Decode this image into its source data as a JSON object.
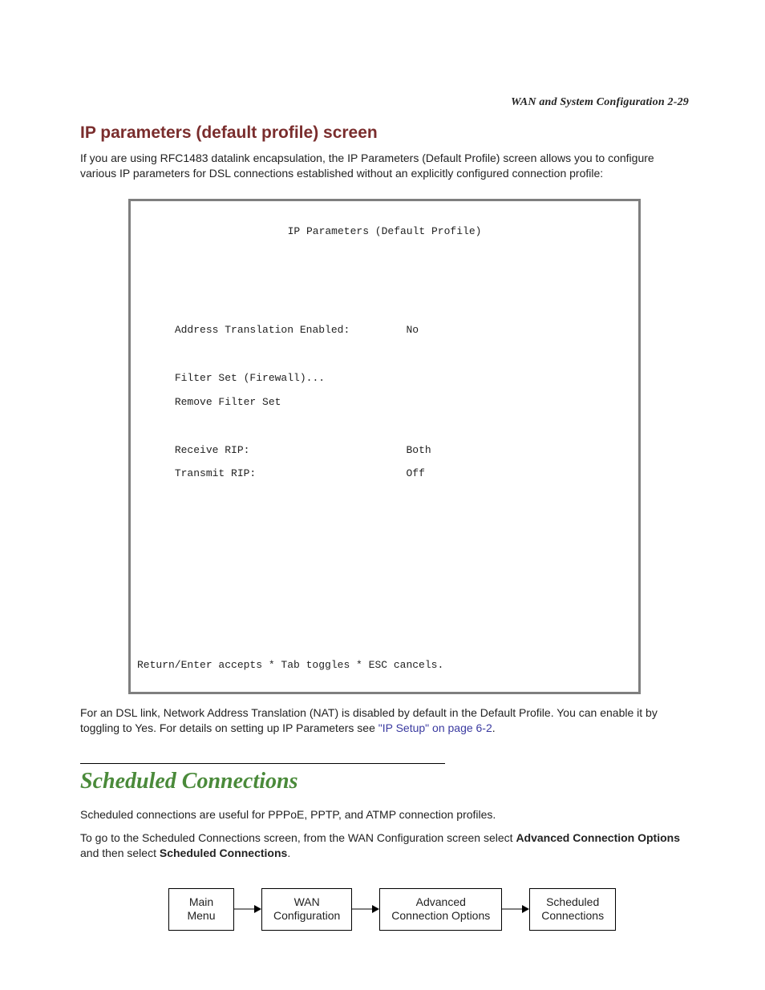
{
  "running_head": "WAN and System Configuration   2-29",
  "section1": {
    "heading": "IP parameters (default profile) screen",
    "para": "If you are using RFC1483 datalink encapsulation, the IP Parameters (Default Profile) screen allows you to configure various IP parameters for DSL connections established without an explicitly configured connection profile:"
  },
  "terminal": {
    "title": "IP Parameters (Default Profile)",
    "rows": [
      {
        "label": "Address Translation Enabled:",
        "value": "No"
      },
      {
        "label": "Filter Set (Firewall)...",
        "value": ""
      },
      {
        "label": "Remove Filter Set",
        "value": ""
      },
      {
        "label": "Receive RIP:",
        "value": "Both"
      },
      {
        "label": "Transmit RIP:",
        "value": "Off"
      }
    ],
    "footer": "Return/Enter accepts * Tab toggles * ESC cancels."
  },
  "after_terminal": {
    "text_a": "For an DSL link, Network Address Translation (NAT) is disabled by default in the Default Profile. You can enable it by toggling to Yes. For details on setting up IP Parameters see ",
    "link": "\"IP Setup\" on page 6-2",
    "text_b": "."
  },
  "section2": {
    "heading": "Scheduled Connections",
    "para1": "Scheduled connections are useful for PPPoE, PPTP, and ATMP connection profiles.",
    "para2_a": "To go to the Scheduled Connections screen, from the WAN Configuration screen select ",
    "para2_b1": "Advanced Connection Options",
    "para2_c": " and then select ",
    "para2_b2": "Scheduled Connections",
    "para2_d": "."
  },
  "nav": {
    "boxes": [
      "Main\nMenu",
      "WAN\nConfiguration",
      "Advanced\nConnection Options",
      "Scheduled\nConnections"
    ]
  }
}
